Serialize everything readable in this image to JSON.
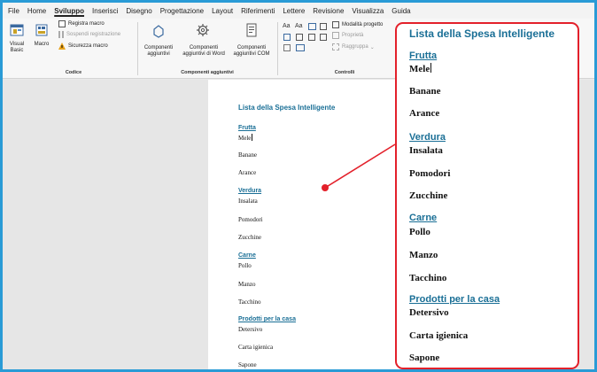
{
  "menu": [
    "File",
    "Home",
    "Sviluppo",
    "Inserisci",
    "Disegno",
    "Progettazione",
    "Layout",
    "Riferimenti",
    "Lettere",
    "Revisione",
    "Visualizza",
    "Guida"
  ],
  "ribbon": {
    "code": {
      "visual_basic": "Visual Basic",
      "macro": "Macro",
      "record_macro": "Registra macro",
      "pause_recording": "Sospendi registrazione",
      "macro_security": "Sicurezza macro",
      "group_label": "Codice"
    },
    "addins": {
      "addins": "Componenti aggiuntivi",
      "word_addins": "Componenti aggiuntivi di Word",
      "com_addins": "Componenti aggiuntivi COM",
      "group_label": "Componenti aggiuntivi"
    },
    "controls": {
      "design_mode": "Modalità progetto",
      "properties": "Proprietà",
      "group": "Raggruppa",
      "group_label": "Controlli"
    }
  },
  "document": {
    "title": "Lista della Spesa Intelligente",
    "sections": [
      {
        "category": "Frutta",
        "items": [
          "Mele",
          "Banane",
          "Arance"
        ]
      },
      {
        "category": "Verdura",
        "items": [
          "Insalata",
          "Pomodori",
          "Zucchine"
        ]
      },
      {
        "category": "Carne",
        "items": [
          "Pollo",
          "Manzo",
          "Tacchino"
        ]
      },
      {
        "category": "Prodotti per la casa",
        "items": [
          "Detersivo",
          "Carta igienica",
          "Sapone"
        ]
      }
    ]
  },
  "colors": {
    "accent": "#1a6f96",
    "callout": "#e3202a",
    "frame": "#2a9bd6"
  }
}
